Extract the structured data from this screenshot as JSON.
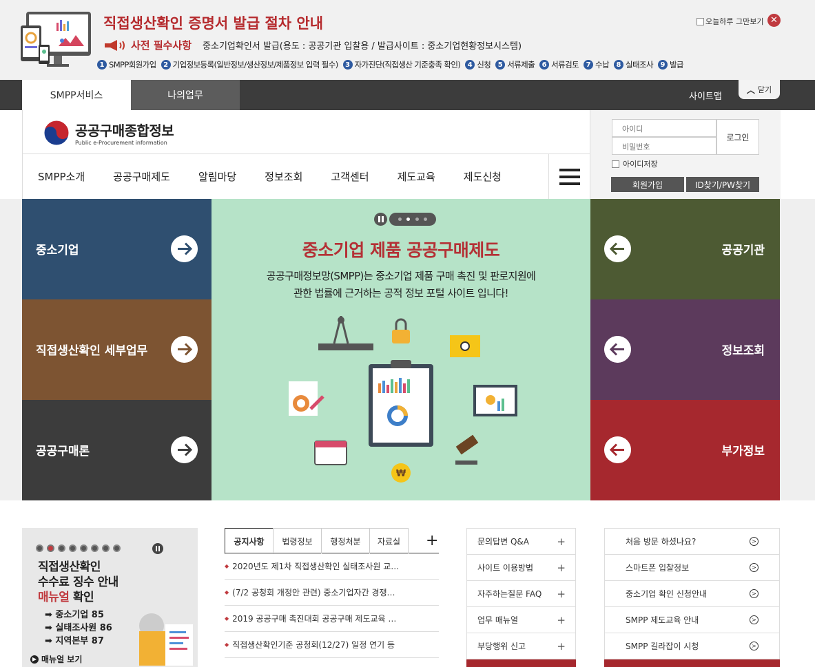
{
  "popup": {
    "title": "직접생산확인 증명서 발급 절차 안내",
    "required_label": "사전 필수사항",
    "required_text": "중소기업확인서 발급(용도 : 공공기관 입찰용 / 발급사이트 : 중소기업현황정보시스템)",
    "steps": [
      {
        "num": "1",
        "label": "SMPP회원가입"
      },
      {
        "num": "2",
        "label": "기업정보등록(일반정보/생산정보/제품정보 입력 필수)"
      },
      {
        "num": "3",
        "label": "자가진단(직접생산 기준충족 확인)"
      },
      {
        "num": "4",
        "label": "신청"
      },
      {
        "num": "5",
        "label": "서류제출"
      },
      {
        "num": "6",
        "label": "서류검토"
      },
      {
        "num": "7",
        "label": "수납"
      },
      {
        "num": "8",
        "label": "실태조사"
      },
      {
        "num": "9",
        "label": "발급"
      }
    ],
    "today_hide": "오늘하루 그만보기"
  },
  "topbar": {
    "tab_smpp": "SMPP서비스",
    "tab_mywork": "나의업무",
    "sitemap": "사이트맵",
    "close": "닫기"
  },
  "header": {
    "logo_ko": "공공구매종합정보",
    "logo_en": "Public e-Procurement information",
    "menu": [
      "SMPP소개",
      "공공구매제도",
      "알림마당",
      "정보조회",
      "고객센터",
      "제도교육",
      "제도신청"
    ]
  },
  "login": {
    "id_placeholder": "아이디",
    "pw_placeholder": "비밀번호",
    "login_button": "로그인",
    "save_id": "아이디저장",
    "join": "회원가입",
    "find": "ID찾기/PW찾기"
  },
  "visual": {
    "left_panels": [
      "중소기업",
      "직접생산확인 세부업무",
      "공공구매론"
    ],
    "right_panels": [
      "공공기관",
      "정보조회",
      "부가정보"
    ],
    "title": "중소기업 제품 공공구매제도",
    "desc_line1": "공공구매정보망(SMPP)는 중소기업 제품 구매 촉진 및 판로지원에",
    "desc_line2": "관한 법률에 근거하는 공적 정보 포털 사이트 입니다!",
    "colors": {
      "left": [
        "#2f4f70",
        "#7d5432",
        "#3c3c3c"
      ],
      "right": [
        "#4d5a33",
        "#5c3a5c",
        "#a6282e"
      ],
      "center": "#b6e3c8",
      "accent": "#b43035"
    }
  },
  "promo": {
    "title_line1": "직접생산확인",
    "title_line2": "수수료 징수 안내",
    "title_red": "매뉴얼",
    "title_rest": " 확인",
    "items": [
      "중소기업 85",
      "실태조사원 86",
      "지역본부 87"
    ],
    "manual": "매뉴얼 보기"
  },
  "notice": {
    "tabs": [
      "공지사항",
      "법령정보",
      "행정처분",
      "자료실"
    ],
    "items": [
      "2020년도 제1차 직접생산확인 실태조사원 교…",
      "(7/2 공청회 개정안 관련) 중소기업자간 경쟁…",
      "2019 공공구매 촉진대회 공공구매 제도교육 …",
      "직접생산확인기준 공청회(12/27) 일정 연기 등"
    ]
  },
  "quick": {
    "items": [
      "문의답변 Q&A",
      "사이트 이용방법",
      "자주하는질문 FAQ",
      "업무 매뉴얼",
      "부당행위 신고"
    ]
  },
  "guide": {
    "items": [
      "처음 방문 하셨나요?",
      "스마트폰 입찰정보",
      "중소기업 확인 신청안내",
      "SMPP 제도교육 안내",
      "SMPP 길라잡이 시청"
    ]
  }
}
